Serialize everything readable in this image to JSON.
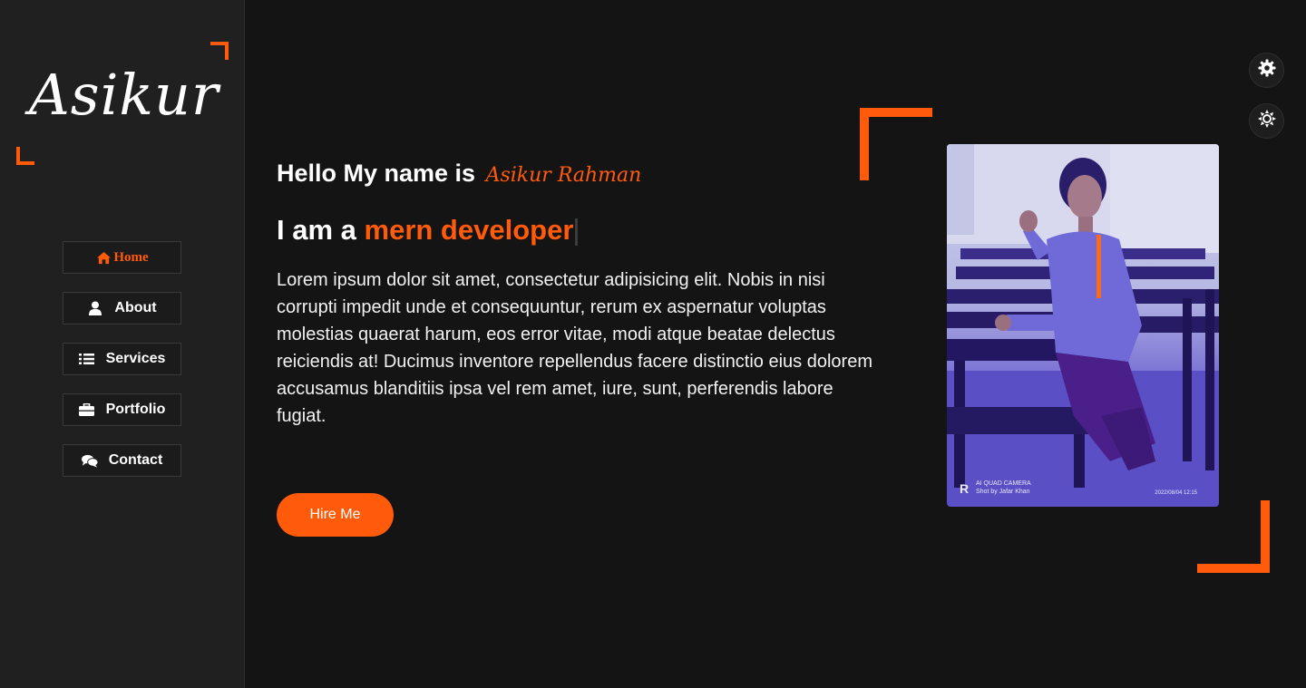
{
  "sidebar": {
    "logo": "Asikur",
    "nav": [
      {
        "label": "Home",
        "icon": "home-icon",
        "active": true
      },
      {
        "label": "About",
        "icon": "user-icon",
        "active": false
      },
      {
        "label": "Services",
        "icon": "list-icon",
        "active": false
      },
      {
        "label": "Portfolio",
        "icon": "briefcase-icon",
        "active": false
      },
      {
        "label": "Contact",
        "icon": "comments-icon",
        "active": false
      }
    ]
  },
  "hero": {
    "greeting": "Hello My name is",
    "name": "Asikur Rahman",
    "role_prefix": "I am a",
    "role_highlight": "mern developer",
    "description": "Lorem ipsum dolor sit amet, consectetur adipisicing elit. Nobis in nisi corrupti impedit unde et consequuntur, rerum ex aspernatur voluptas molestias quaerat harum, eos error vitae, modi atque beatae delectus reiciendis at! Ducimus inventore repellendus facere distinctio eius dolorem accusamus blanditiis ipsa vel rem amet, iure, sunt, perferendis labore fugiat.",
    "cta": "Hire Me"
  },
  "photo": {
    "camera_line1": "AI QUAD CAMERA",
    "camera_line2": "Shot by Jafar Khan",
    "camera_logo": "R",
    "timestamp": "2022/08/04 12:15"
  },
  "floating": {
    "settings_icon": "gear-icon",
    "theme_icon": "sun-icon"
  },
  "colors": {
    "accent": "#ff5b0a",
    "background": "#141414",
    "sidebar": "#202020"
  }
}
